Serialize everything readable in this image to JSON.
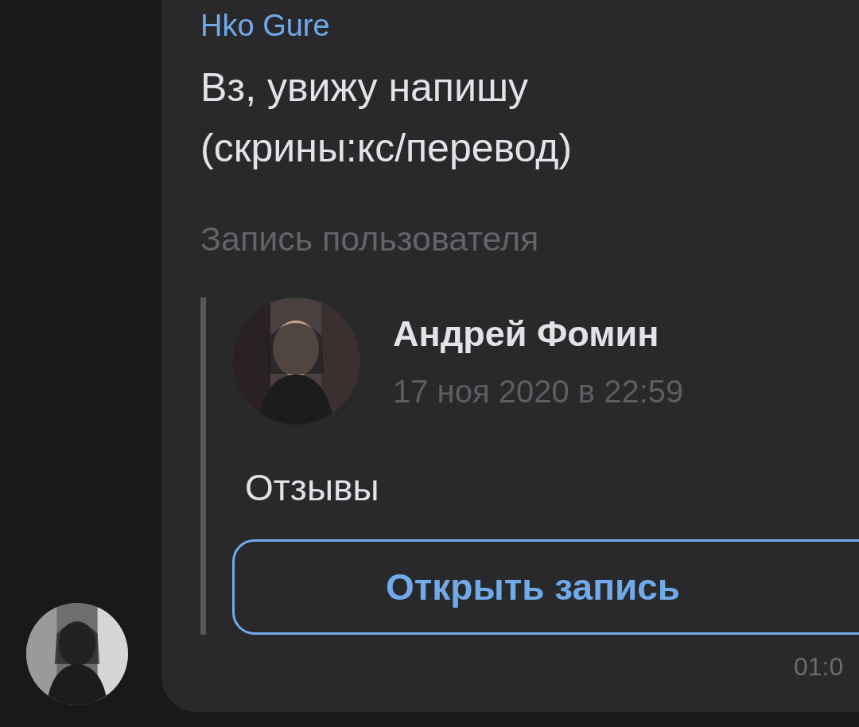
{
  "message": {
    "sender": "Нko Gure",
    "text_lines": [
      "Вз, увижу напишу",
      "(скрины:кс/перевод)"
    ],
    "attachment_label": "Запись пользователя",
    "post": {
      "author": "Андрей Фомин",
      "date": "17 ноя 2020 в 22:59",
      "text": "Отзывы",
      "button": "Открыть запись"
    },
    "time": "01:0"
  }
}
